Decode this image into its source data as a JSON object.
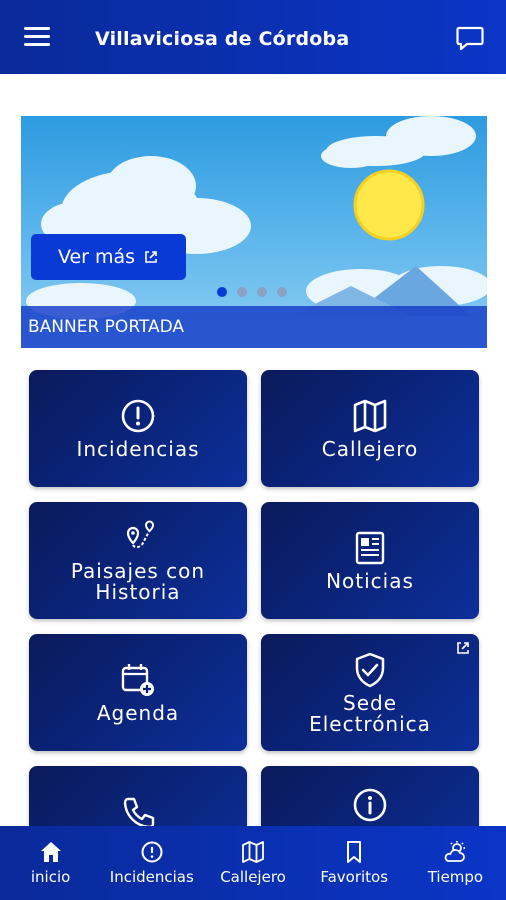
{
  "header": {
    "title": "Villaviciosa de Córdoba"
  },
  "banner": {
    "button_label": "Ver más",
    "caption": "BANNER PORTADA",
    "slides": 4,
    "active_slide": 1
  },
  "tiles": [
    {
      "label": "Incidencias",
      "icon": "alert-circle-icon"
    },
    {
      "label": "Callejero",
      "icon": "map-icon"
    },
    {
      "label": "Paisajes con\nHistoria",
      "icon": "route-pin-icon"
    },
    {
      "label": "Noticias",
      "icon": "newspaper-icon"
    },
    {
      "label": "Agenda",
      "icon": "calendar-add-icon"
    },
    {
      "label": "Sede\nElectrónica",
      "icon": "shield-check-icon",
      "external": true
    },
    {
      "label": "",
      "icon": "phone-icon"
    },
    {
      "label": "",
      "icon": "info-circle-icon"
    }
  ],
  "bottom_nav": [
    {
      "label": "inicio",
      "icon": "home-icon"
    },
    {
      "label": "Incidencias",
      "icon": "alert-circle-icon"
    },
    {
      "label": "Callejero",
      "icon": "map-icon"
    },
    {
      "label": "Favoritos",
      "icon": "bookmark-icon"
    },
    {
      "label": "Tiempo",
      "icon": "sun-cloud-icon"
    }
  ],
  "colors": {
    "primary": "#0a35c6",
    "tile_dark": "#0b1a5a"
  }
}
